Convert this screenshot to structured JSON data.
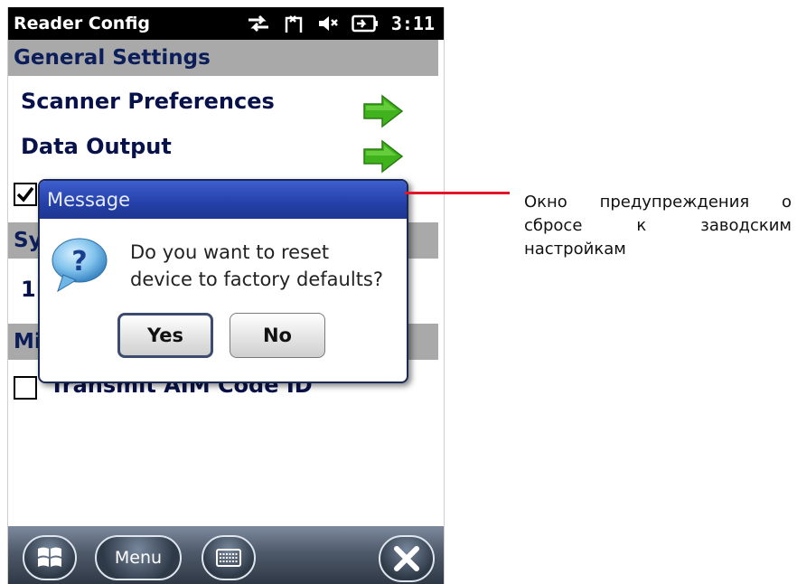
{
  "status_bar": {
    "app_title": "Reader Config",
    "time": "3:11"
  },
  "sections": {
    "general": "General Settings",
    "symbology": "Sy",
    "misc": "Mi"
  },
  "items": {
    "scanner_preferences": "Scanner Preferences",
    "data_output": "Data Output",
    "symbology_partial": "1I",
    "transmit_aim": "Transmit AIM Code ID"
  },
  "dialog": {
    "title": "Message",
    "message_line1": "Do you want to reset",
    "message_line2": "device to factory defaults?",
    "yes_label": "Yes",
    "no_label": "No"
  },
  "taskbar": {
    "menu_label": "Menu"
  },
  "annotation": {
    "text": "Окно предупреждения о сбросе к заводским настройкам"
  },
  "colors": {
    "callout": "#e0162b",
    "dialog_title_bg": "#2440a8",
    "section_bg": "#a9a9a9",
    "arrow_green": "#3fb21c"
  }
}
